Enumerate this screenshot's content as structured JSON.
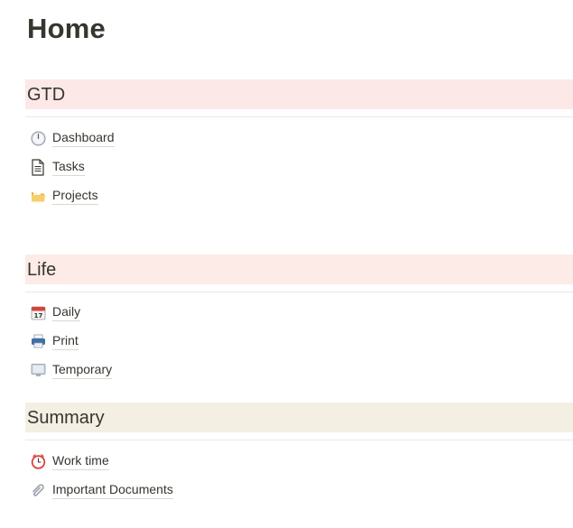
{
  "page": {
    "title": "Home"
  },
  "sections": [
    {
      "title": "GTD",
      "background": "#fde8e8",
      "items": [
        {
          "label": "Dashboard",
          "icon": "clock-icon"
        },
        {
          "label": "Tasks",
          "icon": "document-icon"
        },
        {
          "label": "Projects",
          "icon": "folder-icon"
        }
      ]
    },
    {
      "title": "Life",
      "background": "#fcebe6",
      "items": [
        {
          "label": "Daily",
          "icon": "calendar-icon"
        },
        {
          "label": "Print",
          "icon": "printer-icon"
        },
        {
          "label": "Temporary",
          "icon": "monitor-icon"
        }
      ]
    },
    {
      "title": "Summary",
      "background": "#f4efe3",
      "items": [
        {
          "label": "Work time",
          "icon": "alarm-clock-icon"
        },
        {
          "label": "Important Documents",
          "icon": "paperclip-icon"
        }
      ]
    }
  ]
}
